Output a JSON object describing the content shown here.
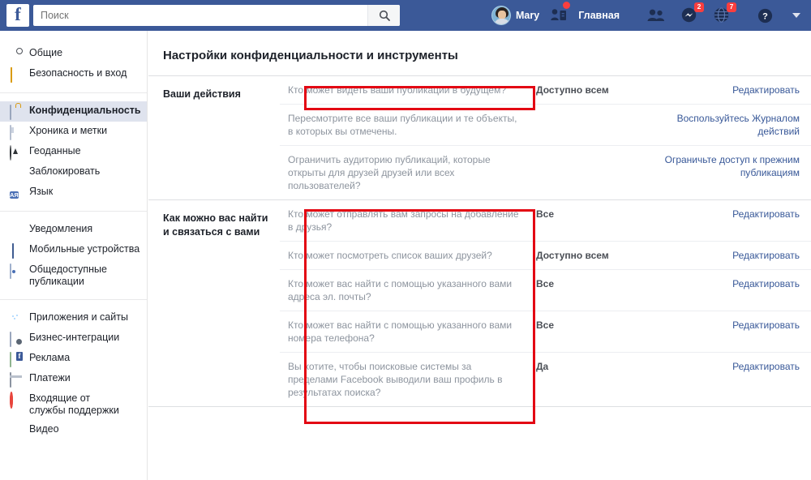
{
  "topbar": {
    "logo": "f",
    "search_placeholder": "Поиск",
    "search_icon": "search-icon",
    "profile_name": "Mary",
    "home_label": "Главная",
    "friend_requests_icon": "friend-requests-icon",
    "friends_icon": "friends-icon",
    "messenger_icon": "messenger-icon",
    "messenger_badge": "2",
    "notifications_icon": "notifications-globe-icon",
    "notifications_badge": "7",
    "help_icon": "help-question-icon",
    "account_menu_icon": "chevron-down-icon"
  },
  "sidebar": {
    "groups": [
      {
        "items": [
          {
            "label": "Общие",
            "icon": "gear-icon",
            "active": false
          },
          {
            "label": "Безопасность и вход",
            "icon": "shield-icon",
            "active": false
          }
        ]
      },
      {
        "items": [
          {
            "label": "Конфиденциальность",
            "icon": "lock-icon",
            "active": true
          },
          {
            "label": "Хроника и метки",
            "icon": "timeline-icon",
            "active": false
          },
          {
            "label": "Геоданные",
            "icon": "location-icon",
            "active": false
          },
          {
            "label": "Заблокировать",
            "icon": "block-icon",
            "active": false
          },
          {
            "label": "Язык",
            "icon": "language-icon",
            "active": false
          }
        ]
      },
      {
        "items": [
          {
            "label": "Уведомления",
            "icon": "notifications-icon",
            "active": false
          },
          {
            "label": "Мобильные устройства",
            "icon": "mobile-icon",
            "active": false
          },
          {
            "label": "Общедоступные публикации",
            "icon": "rss-icon",
            "active": false
          }
        ]
      },
      {
        "items": [
          {
            "label": "Приложения и сайты",
            "icon": "apps-icon",
            "active": false
          },
          {
            "label": "Бизнес-интеграции",
            "icon": "business-icon",
            "active": false
          },
          {
            "label": "Реклама",
            "icon": "ads-icon",
            "active": false
          },
          {
            "label": "Платежи",
            "icon": "payments-icon",
            "active": false
          },
          {
            "label": "Входящие от службы поддержки",
            "icon": "support-icon",
            "active": false
          },
          {
            "label": "Видео",
            "icon": "video-icon",
            "active": false
          }
        ]
      }
    ]
  },
  "main": {
    "title": "Настройки конфиденциальности и инструменты",
    "sections": [
      {
        "heading": "Ваши действия",
        "rows": [
          {
            "question": "Кто может видеть ваши публикации в будущем?",
            "value": "Доступно всем",
            "action": "Редактировать",
            "highlighted": true
          },
          {
            "question": "Пересмотрите все ваши публикации и те объекты, в которых вы отмечены.",
            "value": "",
            "action": "Воспользуйтесь Журналом действий",
            "highlighted": false
          },
          {
            "question": "Ограничить аудиторию публикаций, которые открыты для друзей друзей или всех пользователей?",
            "value": "",
            "action": "Ограничьте доступ к прежним публикациям",
            "highlighted": false
          }
        ]
      },
      {
        "heading": "Как можно вас найти и связаться с вами",
        "rows": [
          {
            "question": "Кто может отправлять вам запросы на добавление в друзья?",
            "value": "Все",
            "action": "Редактировать",
            "highlighted": true
          },
          {
            "question": "Кто может посмотреть список ваших друзей?",
            "value": "Доступно всем",
            "action": "Редактировать",
            "highlighted": true
          },
          {
            "question": "Кто может вас найти с помощью указанного вами адреса эл. почты?",
            "value": "Все",
            "action": "Редактировать",
            "highlighted": true
          },
          {
            "question": "Кто может вас найти с помощью указанного вами номера телефона?",
            "value": "Все",
            "action": "Редактировать",
            "highlighted": true
          },
          {
            "question": "Вы хотите, чтобы поисковые системы за пределами Facebook выводили ваш профиль в результатах поиска?",
            "value": "Да",
            "action": "Редактировать",
            "highlighted": true
          }
        ]
      }
    ]
  },
  "colors": {
    "brand_blue": "#3b5998",
    "link_blue": "#385898",
    "annotation_red": "#e30613",
    "badge_red": "#fa3e3e",
    "active_item_bg": "#dfe3ee"
  }
}
